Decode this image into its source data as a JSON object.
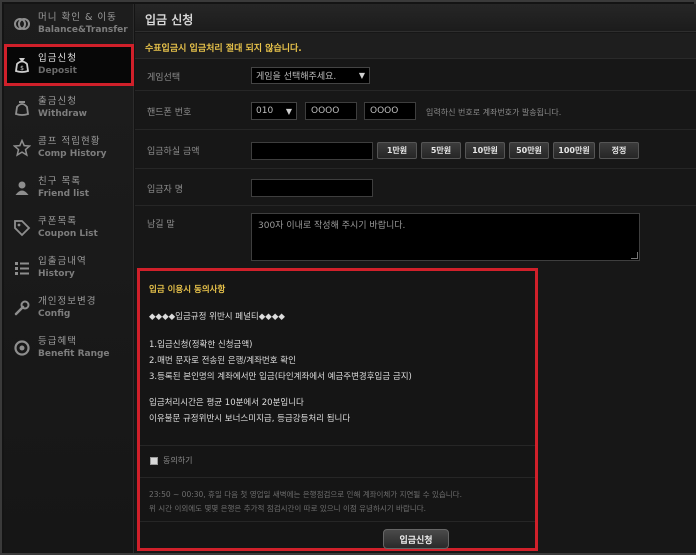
{
  "sidebar": {
    "items": [
      {
        "ko": "머니 확인 & 이동",
        "en": "Balance&Transfer",
        "icon": "money-transfer-icon"
      },
      {
        "ko": "입금신청",
        "en": "Deposit",
        "icon": "deposit-bag-icon"
      },
      {
        "ko": "출금신청",
        "en": "Withdraw",
        "icon": "withdraw-bag-icon"
      },
      {
        "ko": "콤프 적립현황",
        "en": "Comp History",
        "icon": "star-icon"
      },
      {
        "ko": "친구 목록",
        "en": "Friend list",
        "icon": "user-icon"
      },
      {
        "ko": "쿠폰목록",
        "en": "Coupon List",
        "icon": "tag-icon"
      },
      {
        "ko": "입출금내역",
        "en": "History",
        "icon": "list-icon"
      },
      {
        "ko": "개인정보변경",
        "en": "Config",
        "icon": "wrench-icon"
      },
      {
        "ko": "등급혜택",
        "en": "Benefit Range",
        "icon": "ring-icon"
      }
    ]
  },
  "page": {
    "title": "입금 신청",
    "notice": "수표입금시 입금처리 절대 되지 않습니다."
  },
  "form": {
    "game_label": "게임선택",
    "game_select": "게임을 선택해주세요.",
    "phone_label": "핸드폰 번호",
    "phone_prefix": "010",
    "phone_mid": "OOOO",
    "phone_last": "OOOO",
    "phone_hint": "입력하신 번호로 계좌번호가 발송됩니다.",
    "amount_label": "입금하실 금액",
    "amount_buttons": [
      "1만원",
      "5만원",
      "10만원",
      "50만원",
      "100만원",
      "정정"
    ],
    "depositor_label": "입금자 명",
    "message_label": "남길 말",
    "message_placeholder": "300자 이내로 작성해 주시기 바랍니다."
  },
  "terms": {
    "title": "입금 이용시 동의사항",
    "penalty": "◆◆◆◆입금규정 위반시 페널티◆◆◆◆",
    "rule1": "1.입금신청(정확한 신청금액)",
    "rule2": "2.매번 문자로 전송된 은행/계좌번호 확인",
    "rule3": "3.등록된 본인명의 계좌에서만 입금(타인계좌에서 예금주변경후입금 금지)",
    "time1": "입금처리시간은 평균 10분에서 20분입니다",
    "time2": "이유불문 규정위반시 보너스미지급, 등급강등처리 됩니다",
    "agree_label": "동의하기",
    "note1": "23:50 ~ 00:30, 휴일 다음 첫 영업일 새벽에는 은행점검으로 인해 계좌이체가 지연될 수 있습니다.",
    "note2": "위 시간 이외에도 몇몇 은행은 추가적 점검시간이 따로 있으니 이점 유념하시기 바랍니다.",
    "submit_label": "입금신청"
  },
  "colors": {
    "highlight": "#d0202a",
    "notice": "#e7c24a"
  }
}
